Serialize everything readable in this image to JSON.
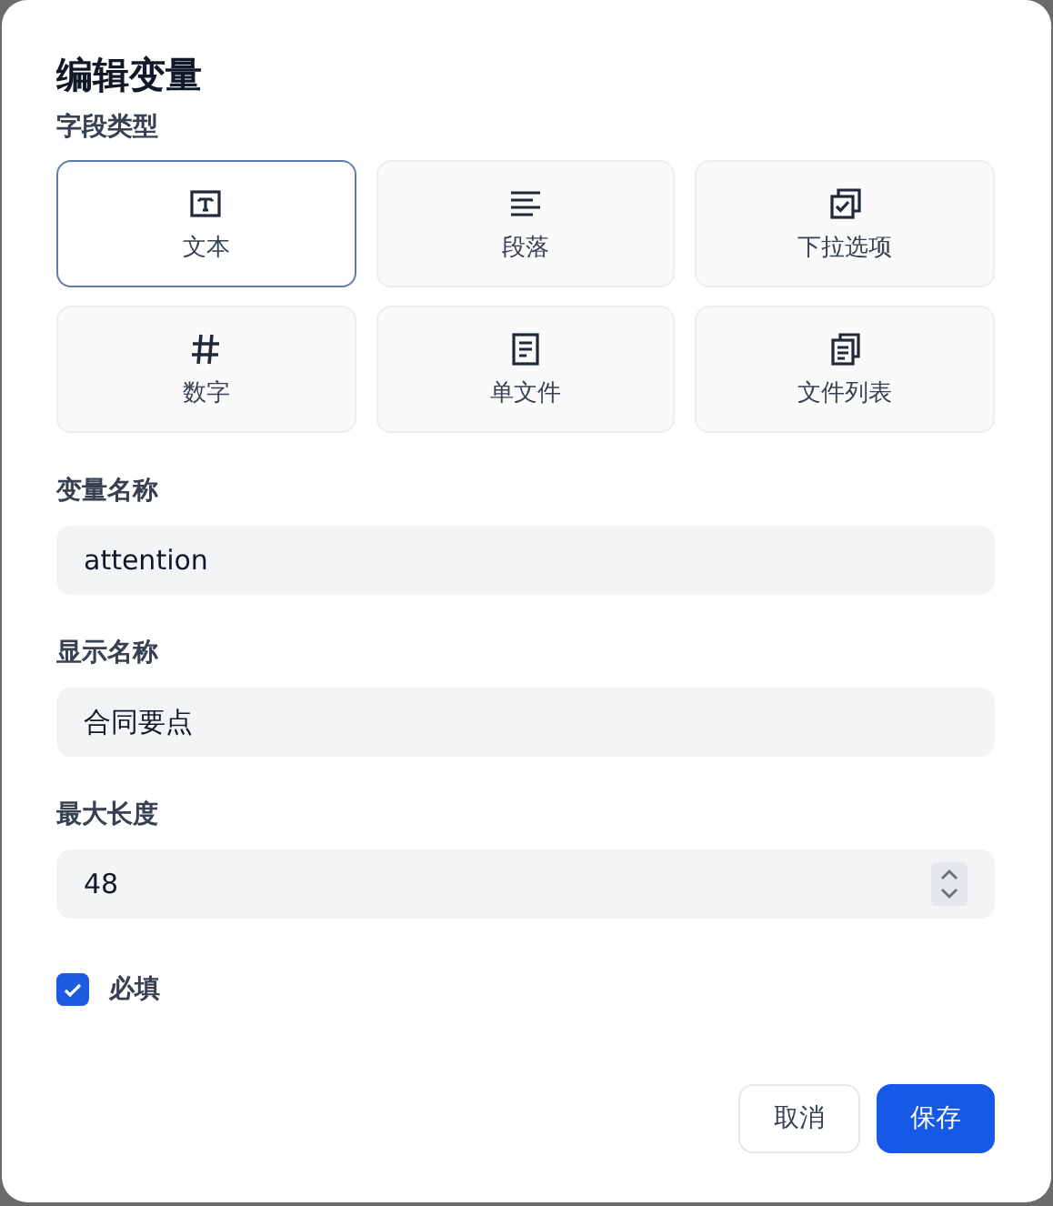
{
  "dialog": {
    "title": "编辑变量"
  },
  "field_type": {
    "label": "字段类型",
    "options": [
      {
        "kind": "text",
        "label": "文本",
        "selected": true
      },
      {
        "kind": "paragraph",
        "label": "段落",
        "selected": false
      },
      {
        "kind": "dropdown",
        "label": "下拉选项",
        "selected": false
      },
      {
        "kind": "number",
        "label": "数字",
        "selected": false
      },
      {
        "kind": "file",
        "label": "单文件",
        "selected": false
      },
      {
        "kind": "file_list",
        "label": "文件列表",
        "selected": false
      }
    ]
  },
  "fields": [
    {
      "kind": "text",
      "label": "变量名称",
      "value": "attention"
    },
    {
      "kind": "text",
      "label": "显示名称",
      "value": "合同要点"
    },
    {
      "kind": "number",
      "label": "最大长度",
      "value": "48"
    }
  ],
  "required": {
    "label": "必填",
    "checked": true
  },
  "buttons": [
    {
      "kind": "secondary",
      "label": "取消"
    },
    {
      "kind": "primary",
      "label": "保存"
    }
  ]
}
